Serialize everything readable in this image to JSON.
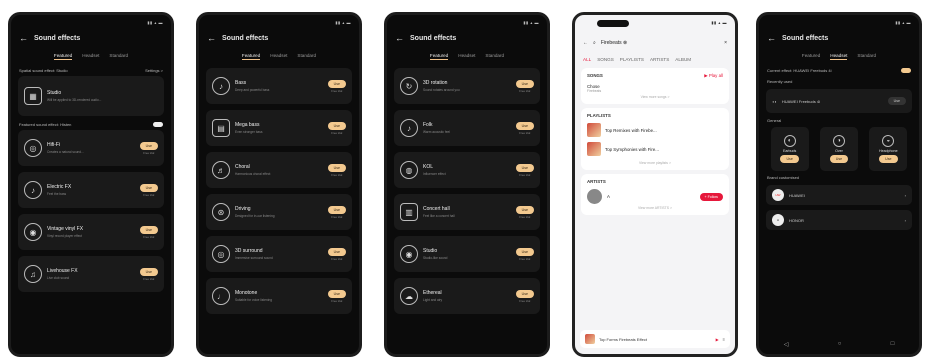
{
  "sound": {
    "title": "Sound effects",
    "tabs": [
      "Featured",
      "Headset",
      "Standard"
    ],
    "screen1": {
      "section_label": "Spatial sound effect: Studio",
      "section_value": "Settings >",
      "studio": {
        "name": "Studio",
        "desc": "Will be applied to 3D-rendered audio..."
      },
      "adjust_label": "Featured sound effect: Histen",
      "rows": [
        {
          "name": "Hifi-Fi",
          "desc": "Creates a natural sound...",
          "btn": "Use",
          "sub": "Free trial"
        },
        {
          "name": "Electric FX",
          "desc": "Feel the bass",
          "btn": "Use",
          "sub": "Free trial"
        },
        {
          "name": "Vintage vinyl FX",
          "desc": "Vinyl record player effect",
          "btn": "Use",
          "sub": "Free trial"
        },
        {
          "name": "Livehouse FX",
          "desc": "Live club sound",
          "btn": "Use",
          "sub": "Free trial"
        }
      ]
    },
    "screen2": {
      "rows": [
        {
          "name": "Bass",
          "desc": "Deep and powerful bass",
          "btn": "Use",
          "sub": "Free trial"
        },
        {
          "name": "Mega bass",
          "desc": "Even stronger bass",
          "btn": "Use",
          "sub": "Free trial"
        },
        {
          "name": "Choral",
          "desc": "Harmonious choral effect",
          "btn": "Use",
          "sub": "Free trial"
        },
        {
          "name": "Driving",
          "desc": "Designed for in-car listening",
          "btn": "Use",
          "sub": "Free trial"
        },
        {
          "name": "3D surround",
          "desc": "Immersive surround sound",
          "btn": "Use",
          "sub": "Free trial"
        },
        {
          "name": "Monotone",
          "desc": "Suitable for voice listening",
          "btn": "Use",
          "sub": "Free trial"
        }
      ]
    },
    "screen3": {
      "rows": [
        {
          "name": "3D rotation",
          "desc": "Sound rotates around you",
          "btn": "Use",
          "sub": "Free trial"
        },
        {
          "name": "Folk",
          "desc": "Warm acoustic feel",
          "btn": "Use",
          "sub": "Free trial"
        },
        {
          "name": "KOL",
          "desc": "Influencer effect",
          "btn": "Use",
          "sub": "Free trial"
        },
        {
          "name": "Concert hall",
          "desc": "Feel like a concert hall",
          "btn": "Use",
          "sub": "Free trial"
        },
        {
          "name": "Studio",
          "desc": "Studio-like sound",
          "btn": "Use",
          "sub": "Free trial"
        },
        {
          "name": "Ethereal",
          "desc": "Light and airy",
          "btn": "Use",
          "sub": "Free trial"
        }
      ]
    }
  },
  "music": {
    "search_text": "Firebeats ⊗",
    "cancel": "×",
    "tabs": [
      "ALL",
      "SONGS",
      "PLAYLISTS",
      "ARTISTS",
      "ALBUM"
    ],
    "songs_label": "SONGS",
    "play_all": "▶ Play all",
    "song_name": "Chose",
    "song_artist": "Firebeats",
    "more_songs": "View more songs >",
    "playlists_label": "PLAYLISTS",
    "playlists": [
      {
        "name": "Top Remixes with Firebe..."
      },
      {
        "name": "Top Symphonies with Fire..."
      }
    ],
    "more_playlists": "View more playlists >",
    "artists_label": "ARTISTS",
    "artist_name": "A",
    "follow": "+ Follow",
    "more_artists": "View more ARTISTS >",
    "player_title": "Top Forms Firebeats Effect"
  },
  "headset": {
    "title": "Sound effects",
    "tabs": [
      "Featured",
      "Headset",
      "Standard"
    ],
    "current": "Current effect: HUAWEI Freebuds 4i",
    "recent_label": "Recently used",
    "recent_name": "HUAWEI Freebuds 4i",
    "recent_btn": "Use",
    "general_label": "General",
    "general": [
      {
        "name": "Earbuds",
        "btn": "Use"
      },
      {
        "name": "Over",
        "btn": "Use"
      },
      {
        "name": "Headphone",
        "btn": "Use"
      }
    ],
    "brand_label": "Brand customised",
    "brands": [
      {
        "name": "HUAWEI",
        "logo": "HW"
      },
      {
        "name": "HONOR",
        "logo": "H"
      }
    ],
    "nav": [
      "◁",
      "○",
      "□"
    ]
  }
}
